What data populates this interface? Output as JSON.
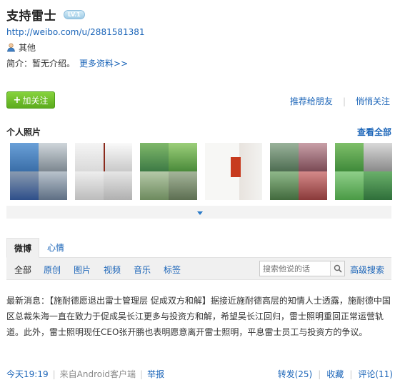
{
  "profile": {
    "name": "支持雷士",
    "level_badge": "LV.1",
    "url": "http://weibo.com/u/2881581381",
    "gender_label": "其他",
    "intro_label": "简介：暂无介绍。",
    "more_info_link": "更多资料>>"
  },
  "actions": {
    "follow_label": "加关注",
    "recommend_label": "推荐给朋友",
    "secret_follow_label": "悄悄关注"
  },
  "photos": {
    "title": "个人照片",
    "see_all": "查看全部"
  },
  "feed_tabs": [
    "微博",
    "心情"
  ],
  "filters": [
    "全部",
    "原创",
    "图片",
    "视频",
    "音乐",
    "标签"
  ],
  "search": {
    "placeholder": "搜索他说的话",
    "advanced_label": "高级搜索"
  },
  "post": {
    "text": "最新消息：【施耐德愿退出雷士管理层 促成双方和解】据接近施耐德高层的知情人士透露，施耐德中国区总裁朱海一直在致力于促成吴长江更多与投资方和解，希望吴长江回归，雷士照明重回正常运营轨道。此外，雷士照明现任CEO张开鹏也表明愿意离开雷士照明，平息雷士员工与投资方的争议。",
    "time": "今天19:19",
    "source": "来自Android客户端",
    "report": "举报",
    "repost": "转发(25)",
    "favorite": "收藏",
    "comment": "评论(11)"
  },
  "colors": {
    "link": "#1a64b8",
    "follow_button": "#6cbf26"
  }
}
